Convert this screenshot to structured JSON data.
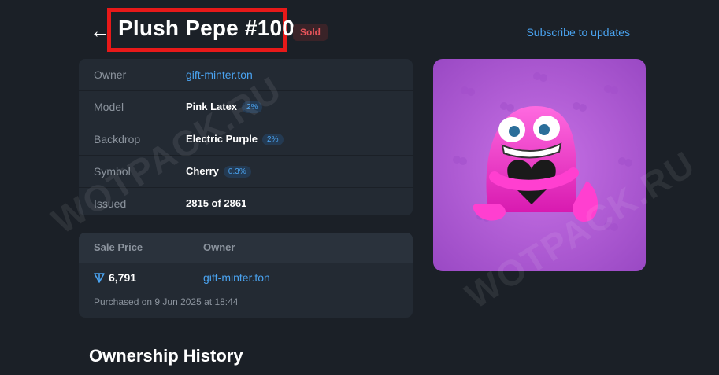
{
  "header": {
    "back_icon": "arrow-left-icon",
    "title": "Plush Pepe #100",
    "status_badge": "Sold",
    "subscribe_link": "Subscribe to updates"
  },
  "info": {
    "rows": [
      {
        "label": "Owner",
        "value": "gift-minter.ton"
      },
      {
        "label": "Model",
        "value": "Pink Latex",
        "pill": "2%"
      },
      {
        "label": "Backdrop",
        "value": "Electric Purple",
        "pill": "2%"
      },
      {
        "label": "Symbol",
        "value": "Cherry",
        "pill": "0.3%"
      },
      {
        "label": "Issued",
        "value": "2815 of 2861"
      }
    ]
  },
  "sale": {
    "headers": [
      "Sale Price",
      "Owner"
    ],
    "currency_icon": "ton-icon",
    "price": "6,791",
    "owner": "gift-minter.ton",
    "purchased": "Purchased on 9 Jun 2025 at 18:44"
  },
  "section": {
    "ownership_history": "Ownership History"
  },
  "watermark": "WOTPACK.RU",
  "colors": {
    "background": "#1b2027",
    "panel": "#232a33",
    "link": "#4aa3f0",
    "sold": "#e8545a",
    "highlight_box": "#e81919",
    "backdrop": "#b561d8"
  }
}
